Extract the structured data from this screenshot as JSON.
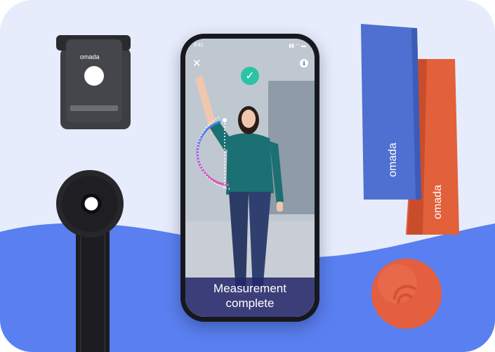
{
  "brand": {
    "name": "omada"
  },
  "phone": {
    "status_time": "9:41",
    "status_icons": "▮▮ ◠ ▬",
    "close_icon": "✕",
    "info_icon": "i",
    "check_icon": "✓",
    "caption_line1": "Measurement",
    "caption_line2": "complete"
  },
  "colors": {
    "background": "#e6ecfb",
    "wave": "#5a7ff0",
    "blue_band": "#4f6fd1",
    "orange_band": "#e2603a",
    "ball": "#e45f3f",
    "check": "#2bc4a5",
    "caption_bg": "#232669",
    "arc_gradient": [
      "#2d8cf0",
      "#a15ce8",
      "#e84fb0"
    ]
  }
}
